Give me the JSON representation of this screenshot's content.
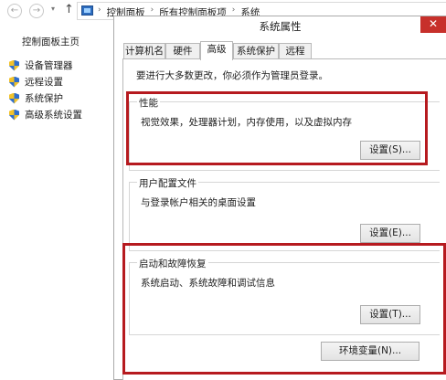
{
  "nav": {
    "back_glyph": "←",
    "forward_glyph": "→",
    "caret_glyph": "▾",
    "up_glyph": "↑",
    "breadcrumb": [
      "控制面板",
      "所有控制面板项",
      "系统"
    ],
    "separator": "›"
  },
  "left_pane": {
    "home_link": "控制面板主页",
    "tasks": [
      "设备管理器",
      "远程设置",
      "系统保护",
      "高级系统设置"
    ]
  },
  "dialog": {
    "title": "系统属性",
    "close_glyph": "✕",
    "tabs": [
      "计算机名",
      "硬件",
      "高级",
      "系统保护",
      "远程"
    ],
    "active_tab": "高级",
    "admin_note": "要进行大多数更改，你必须作为管理员登录。",
    "performance": {
      "legend": "性能",
      "description": "视觉效果，处理器计划，内存使用，以及虚拟内存",
      "button": "设置(S)..."
    },
    "user_profiles": {
      "legend": "用户配置文件",
      "description": "与登录帐户相关的桌面设置",
      "button": "设置(E)..."
    },
    "startup_recovery": {
      "legend": "启动和故障恢复",
      "description": "系统启动、系统故障和调试信息",
      "button": "设置(T)..."
    },
    "env_button": "环境变量(N)..."
  },
  "colors": {
    "highlight": "#b61a1f",
    "close_button": "#c7302b"
  }
}
